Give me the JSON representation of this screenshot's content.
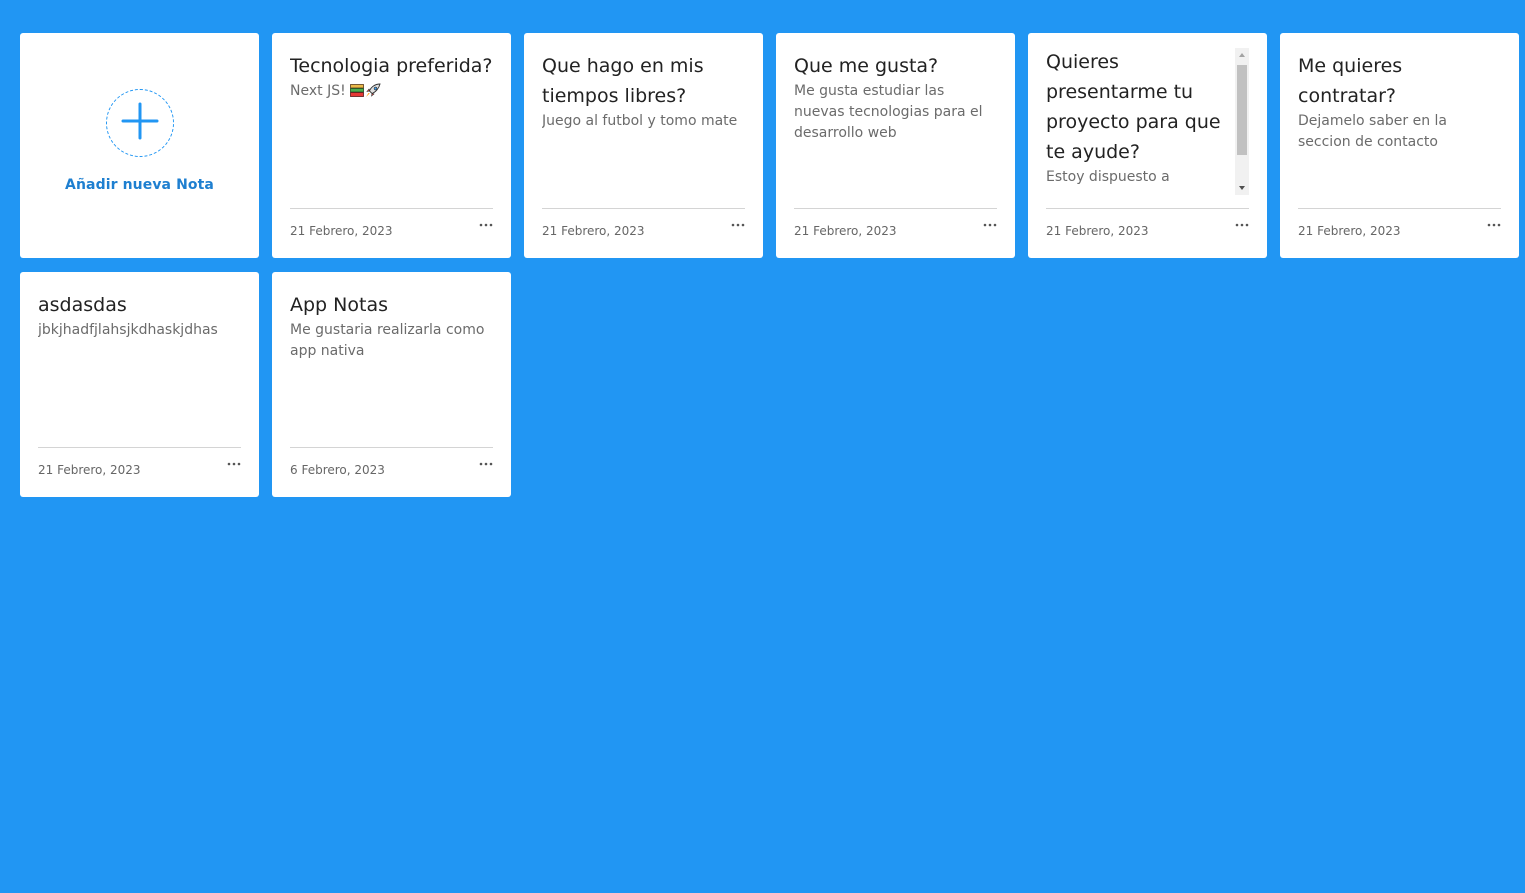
{
  "colors": {
    "background": "#2196f3",
    "card": "#ffffff",
    "accent": "#1e7fd0"
  },
  "add_note": {
    "icon": "plus-icon",
    "label": "Añadir nueva Nota"
  },
  "notes": [
    {
      "title": "Tecnologia preferida?",
      "body": "Next JS!",
      "emojis": [
        "books-icon",
        "rocket-icon"
      ],
      "date": "21 Febrero, 2023",
      "more_icon": "more-horizontal-icon"
    },
    {
      "title": "Que hago en mis tiempos libres?",
      "body": "Juego al futbol y tomo mate",
      "date": "21 Febrero, 2023",
      "more_icon": "more-horizontal-icon"
    },
    {
      "title": "Que me gusta?",
      "body": "Me gusta estudiar las nuevas tecnologias para el desarrollo web",
      "date": "21 Febrero, 2023",
      "more_icon": "more-horizontal-icon"
    },
    {
      "title": "Quieres presentarme tu proyecto para que te ayude?",
      "body": "Estoy dispuesto a",
      "date": "21 Febrero, 2023",
      "more_icon": "more-horizontal-icon",
      "scrollable": true
    },
    {
      "title": "Me quieres contratar?",
      "body": "Dejamelo saber en la seccion de contacto",
      "date": "21 Febrero, 2023",
      "more_icon": "more-horizontal-icon"
    },
    {
      "title": "asdasdas",
      "body": "jbkjhadfjlahsjkdhaskjdhas",
      "date": "21 Febrero, 2023",
      "more_icon": "more-horizontal-icon"
    },
    {
      "title": "App Notas",
      "body": "Me gustaria realizarla como app nativa",
      "date": "6 Febrero, 2023",
      "more_icon": "more-horizontal-icon"
    }
  ]
}
